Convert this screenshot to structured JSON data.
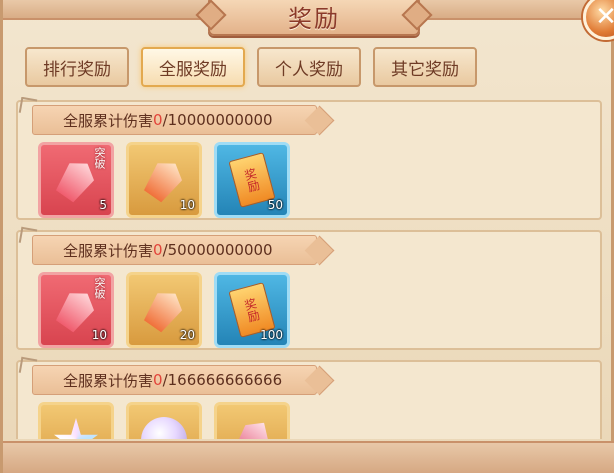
{
  "title": "奖励",
  "close_icon": "close-x-icon",
  "tabs": [
    {
      "label": "排行奖励",
      "active": false
    },
    {
      "label": "全服奖励",
      "active": true
    },
    {
      "label": "个人奖励",
      "active": false
    },
    {
      "label": "其它奖励",
      "active": false
    }
  ],
  "sections": [
    {
      "label": "全服累计伤害",
      "current": "0",
      "target": "/10000000000",
      "items": [
        {
          "icon": "breakthrough-crystal-icon",
          "tag": "突破",
          "count": "5"
        },
        {
          "icon": "orange-crystal-icon",
          "tag": "",
          "count": "10"
        },
        {
          "icon": "reward-scroll-icon",
          "tag": "",
          "count": "50"
        }
      ]
    },
    {
      "label": "全服累计伤害",
      "current": "0",
      "target": "/50000000000",
      "items": [
        {
          "icon": "breakthrough-crystal-icon",
          "tag": "突破",
          "count": "10"
        },
        {
          "icon": "orange-crystal-icon",
          "tag": "",
          "count": "20"
        },
        {
          "icon": "reward-scroll-icon",
          "tag": "",
          "count": "100"
        }
      ]
    },
    {
      "label": "全服累计伤害",
      "current": "0",
      "target": "/166666666666",
      "items": [
        {
          "icon": "star-crystal-icon"
        },
        {
          "icon": "purple-orb-icon"
        },
        {
          "icon": "pink-shard-icon"
        }
      ]
    }
  ],
  "scroll_text": "奖励",
  "colors": {
    "accent_red": "#e2443a",
    "text_brown": "#5e2f1e"
  }
}
